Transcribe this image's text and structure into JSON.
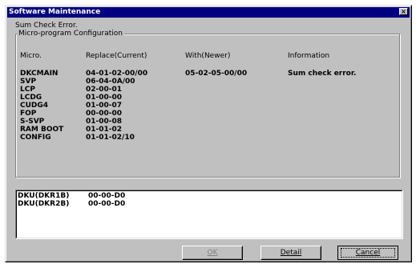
{
  "window": {
    "title": "Software Maintenance",
    "close_glyph": "×"
  },
  "status": "Sum Check Error.",
  "group": {
    "label": "Micro-program Configuration"
  },
  "table": {
    "headers": [
      "Micro.",
      "Replace(Current)",
      "With(Newer)",
      "Information"
    ],
    "rows": [
      [
        "DKCMAIN",
        "04-01-02-00/00",
        "05-02-05-00/00",
        "Sum check error."
      ],
      [
        "SVP",
        "06-04-0A/00",
        "",
        ""
      ],
      [
        "LCP",
        "02-00-01",
        "",
        ""
      ],
      [
        "LCDG",
        "01-00-00",
        "",
        ""
      ],
      [
        "CUDG4",
        "01-00-07",
        "",
        ""
      ],
      [
        "FOP",
        "00-00-00",
        "",
        ""
      ],
      [
        "S-SVP",
        "01-00-08",
        "",
        ""
      ],
      [
        "RAM BOOT",
        "01-01-02",
        "",
        ""
      ],
      [
        "CONFIG",
        "01-01-02/10",
        "",
        ""
      ]
    ]
  },
  "dku_list": [
    [
      "DKU(DKR1B)",
      "00-00-D0"
    ],
    [
      "DKU(DKR2B)",
      "00-00-D0"
    ]
  ],
  "buttons": {
    "ok": "OK",
    "detail": "Detail",
    "cancel": "Cancel"
  }
}
